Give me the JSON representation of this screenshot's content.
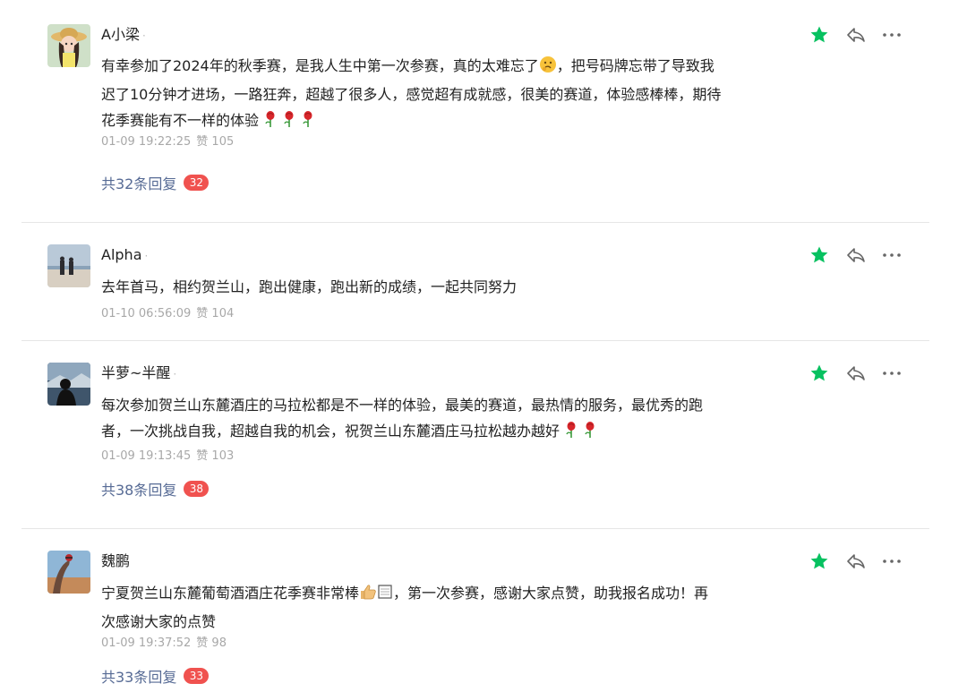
{
  "comments": [
    {
      "username": "A小梁",
      "text_lines": [
        "有幸参加了2024年的秋季赛，是我人生中第一次参赛，真的太难忘了",
        "，把号码牌忘带了导致我",
        "迟了10分钟才进场，一路狂奔，超越了很多人，感觉超有成就感，很美的赛道，体验感棒棒，期待",
        "花季赛能有不一样的体验"
      ],
      "timestamp": "01-09 19:22:25",
      "likes": "赞 105",
      "replies_label": "共32条回复",
      "replies_count": "32",
      "emojis": [
        "thinking-face",
        "rose",
        "rose",
        "rose"
      ]
    },
    {
      "username": "Alpha",
      "text_lines": [
        "去年首马，相约贺兰山，跑出健康，跑出新的成绩，一起共同努力"
      ],
      "timestamp": "01-10 06:56:09",
      "likes": "赞 104"
    },
    {
      "username": "半萝~半醒",
      "text_lines": [
        "每次参加贺兰山东麓酒庄的马拉松都是不一样的体验，最美的赛道，最热情的服务，最优秀的跑",
        "者，一次挑战自我，超越自我的机会，祝贺兰山东麓酒庄马拉松越办越好"
      ],
      "timestamp": "01-09 19:13:45",
      "likes": "赞 103",
      "replies_label": "共38条回复",
      "replies_count": "38",
      "emojis": [
        "rose",
        "rose"
      ]
    },
    {
      "username": "魏鹏",
      "text_lines": [
        "宁夏贺兰山东麓葡萄酒酒庄花季赛非常棒",
        "，第一次参赛，感谢大家点赞，助我报名成功！再",
        "次感谢大家的点赞"
      ],
      "timestamp": "01-09 19:37:52",
      "likes": "赞 98",
      "replies_label": "共33条回复",
      "replies_count": "33",
      "emojis": [
        "thumbs-up",
        "square-symbol"
      ]
    }
  ],
  "colors": {
    "star": "#07c160",
    "reply_link": "#576b95",
    "badge": "#f0524f",
    "meta": "#a8a8a8"
  },
  "icons": [
    "star-icon",
    "share-icon",
    "more-icon"
  ]
}
